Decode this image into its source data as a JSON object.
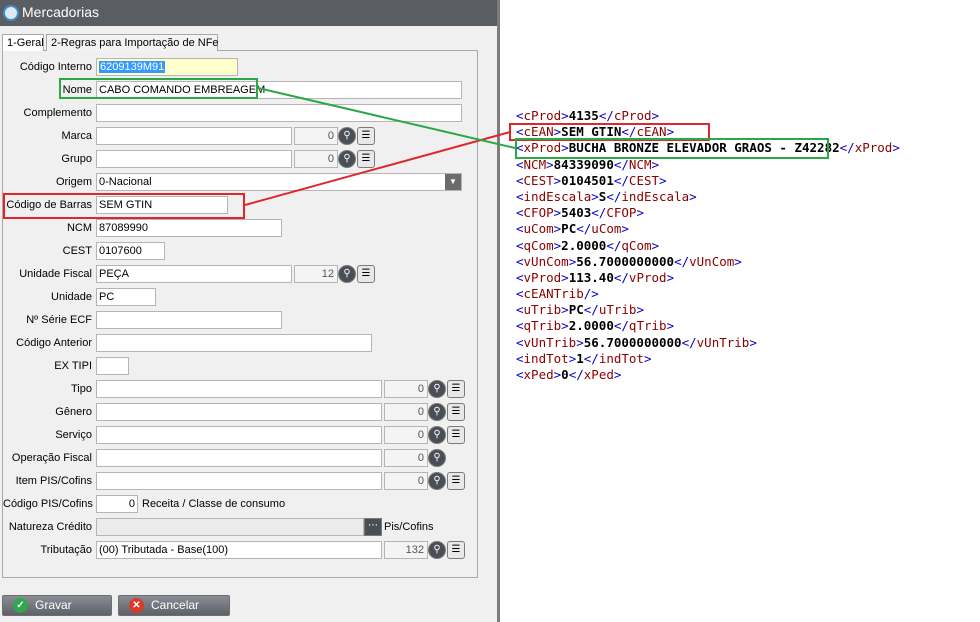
{
  "window": {
    "title": "Mercadorias"
  },
  "tabs": [
    {
      "label": "1-Geral",
      "active": true
    },
    {
      "label": "2-Regras para Importação de NFe",
      "active": false
    }
  ],
  "form": {
    "codigo_interno": {
      "label": "Código Interno",
      "value": "6209139M91"
    },
    "nome": {
      "label": "Nome",
      "value": "CABO COMANDO EMBREAGEM"
    },
    "complemento": {
      "label": "Complemento",
      "value": ""
    },
    "marca": {
      "label": "Marca",
      "value": "",
      "code": "0"
    },
    "grupo": {
      "label": "Grupo",
      "value": "",
      "code": "0"
    },
    "origem": {
      "label": "Origem",
      "value": "0-Nacional"
    },
    "codigo_barras": {
      "label": "Código de Barras",
      "value": "SEM GTIN"
    },
    "ncm": {
      "label": "NCM",
      "value": "87089990"
    },
    "cest": {
      "label": "CEST",
      "value": "0107600"
    },
    "unidade_fiscal": {
      "label": "Unidade Fiscal",
      "value": "PEÇA",
      "code": "12"
    },
    "unidade": {
      "label": "Unidade",
      "value": "PC"
    },
    "serie_ecf": {
      "label": "Nº Série ECF",
      "value": ""
    },
    "codigo_anterior": {
      "label": "Código Anterior",
      "value": ""
    },
    "ex_tipi": {
      "label": "EX TIPI",
      "value": ""
    },
    "tipo": {
      "label": "Tipo",
      "value": "",
      "code": "0"
    },
    "genero": {
      "label": "Gênero",
      "value": "",
      "code": "0"
    },
    "servico": {
      "label": "Serviço",
      "value": "",
      "code": "0"
    },
    "operacao_fiscal": {
      "label": "Operação Fiscal",
      "value": "",
      "code": "0"
    },
    "item_pis_cofins": {
      "label": "Item PIS/Cofins",
      "value": "",
      "code": "0"
    },
    "codigo_pis_cofins": {
      "label": "Código PIS/Cofins",
      "value": "0",
      "desc": "Receita / Classe de consumo"
    },
    "natureza_credito": {
      "label": "Natureza Crédito",
      "value": "",
      "suffix": "Pis/Cofins"
    },
    "tributacao": {
      "label": "Tributação",
      "value": "(00) Tributada  - Base(100)",
      "code": "132"
    }
  },
  "buttons": {
    "save": "Gravar",
    "cancel": "Cancelar"
  },
  "xml_lines": [
    {
      "tag": "cProd",
      "value": "4135"
    },
    {
      "tag": "cEAN",
      "value": "SEM GTIN"
    },
    {
      "tag": "xProd",
      "value": "BUCHA BRONZE ELEVADOR GRAOS - Z42282"
    },
    {
      "tag": "NCM",
      "value": "84339090"
    },
    {
      "tag": "CEST",
      "value": "0104501"
    },
    {
      "tag": "indEscala",
      "value": "S"
    },
    {
      "tag": "CFOP",
      "value": "5403"
    },
    {
      "tag": "uCom",
      "value": "PC"
    },
    {
      "tag": "qCom",
      "value": "2.0000"
    },
    {
      "tag": "vUnCom",
      "value": "56.7000000000"
    },
    {
      "tag": "vProd",
      "value": "113.40"
    },
    {
      "tag": "cEANTrib",
      "value": null
    },
    {
      "tag": "uTrib",
      "value": "PC"
    },
    {
      "tag": "qTrib",
      "value": "2.0000"
    },
    {
      "tag": "vUnTrib",
      "value": "56.7000000000"
    },
    {
      "tag": "indTot",
      "value": "1"
    },
    {
      "tag": "xPed",
      "value": "0"
    }
  ],
  "colors": {
    "highlight_red": "#e0262a",
    "highlight_green": "#2aa845",
    "title_bar": "#5a5e63"
  },
  "icons": {
    "save": "check-circle-icon",
    "cancel": "x-circle-icon",
    "lookup": "magnifier-icon",
    "list": "list-icon"
  }
}
